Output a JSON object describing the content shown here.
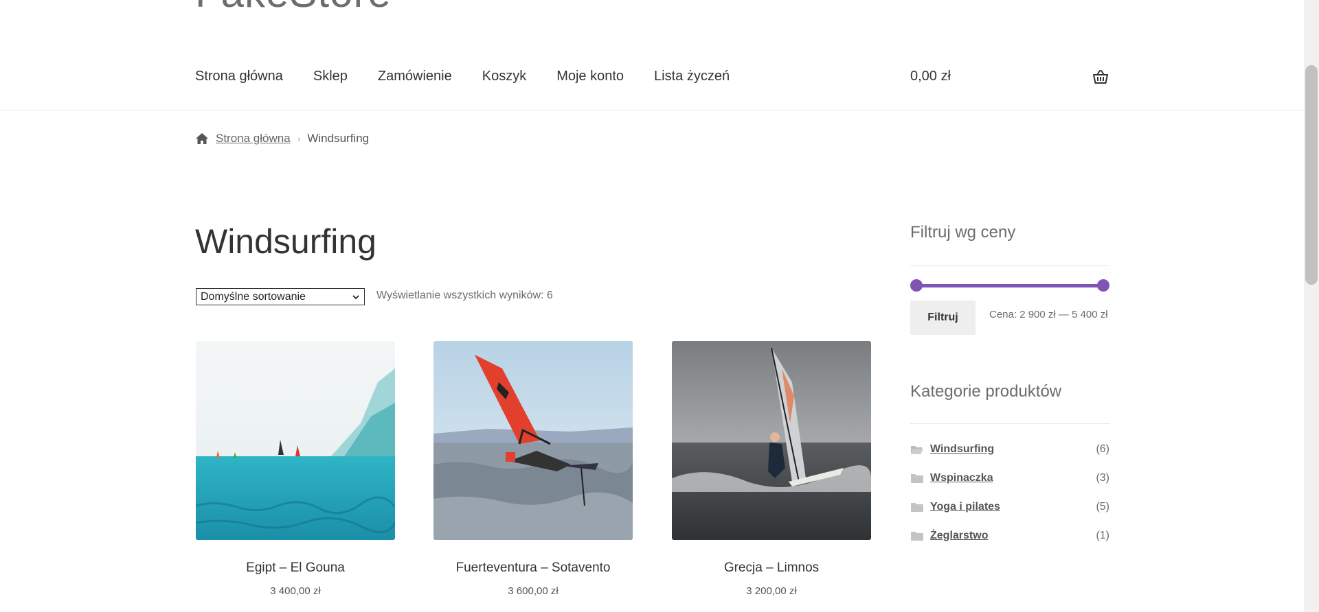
{
  "header": {
    "logo": "FakeStore",
    "nav": [
      "Strona główna",
      "Sklep",
      "Zamówienie",
      "Koszyk",
      "Moje konto",
      "Lista życzeń"
    ],
    "cart_total": "0,00 zł"
  },
  "breadcrumb": {
    "home_label": "Strona główna",
    "separator": "›",
    "current": "Windsurfing"
  },
  "page_title": "Windsurfing",
  "sorting": {
    "selected": "Domyślne sortowanie",
    "result_count": "Wyświetlanie wszystkich wyników: 6"
  },
  "products": [
    {
      "title": "Egipt – El Gouna",
      "price": "3 400,00 zł"
    },
    {
      "title": "Fuerteventura – Sotavento",
      "price": "3 600,00 zł"
    },
    {
      "title": "Grecja – Limnos",
      "price": "3 200,00 zł"
    }
  ],
  "sidebar": {
    "price_filter": {
      "title": "Filtruj wg ceny",
      "button": "Filtruj",
      "range_text": "Cena: 2 900 zł — 5 400 zł",
      "slider_color": "#7f54b3"
    },
    "categories": {
      "title": "Kategorie produktów",
      "items": [
        {
          "name": "Windsurfing",
          "count": "(6)"
        },
        {
          "name": "Wspinaczka",
          "count": "(3)"
        },
        {
          "name": "Yoga i pilates",
          "count": "(5)"
        },
        {
          "name": "Żeglarstwo",
          "count": "(1)"
        }
      ]
    }
  }
}
